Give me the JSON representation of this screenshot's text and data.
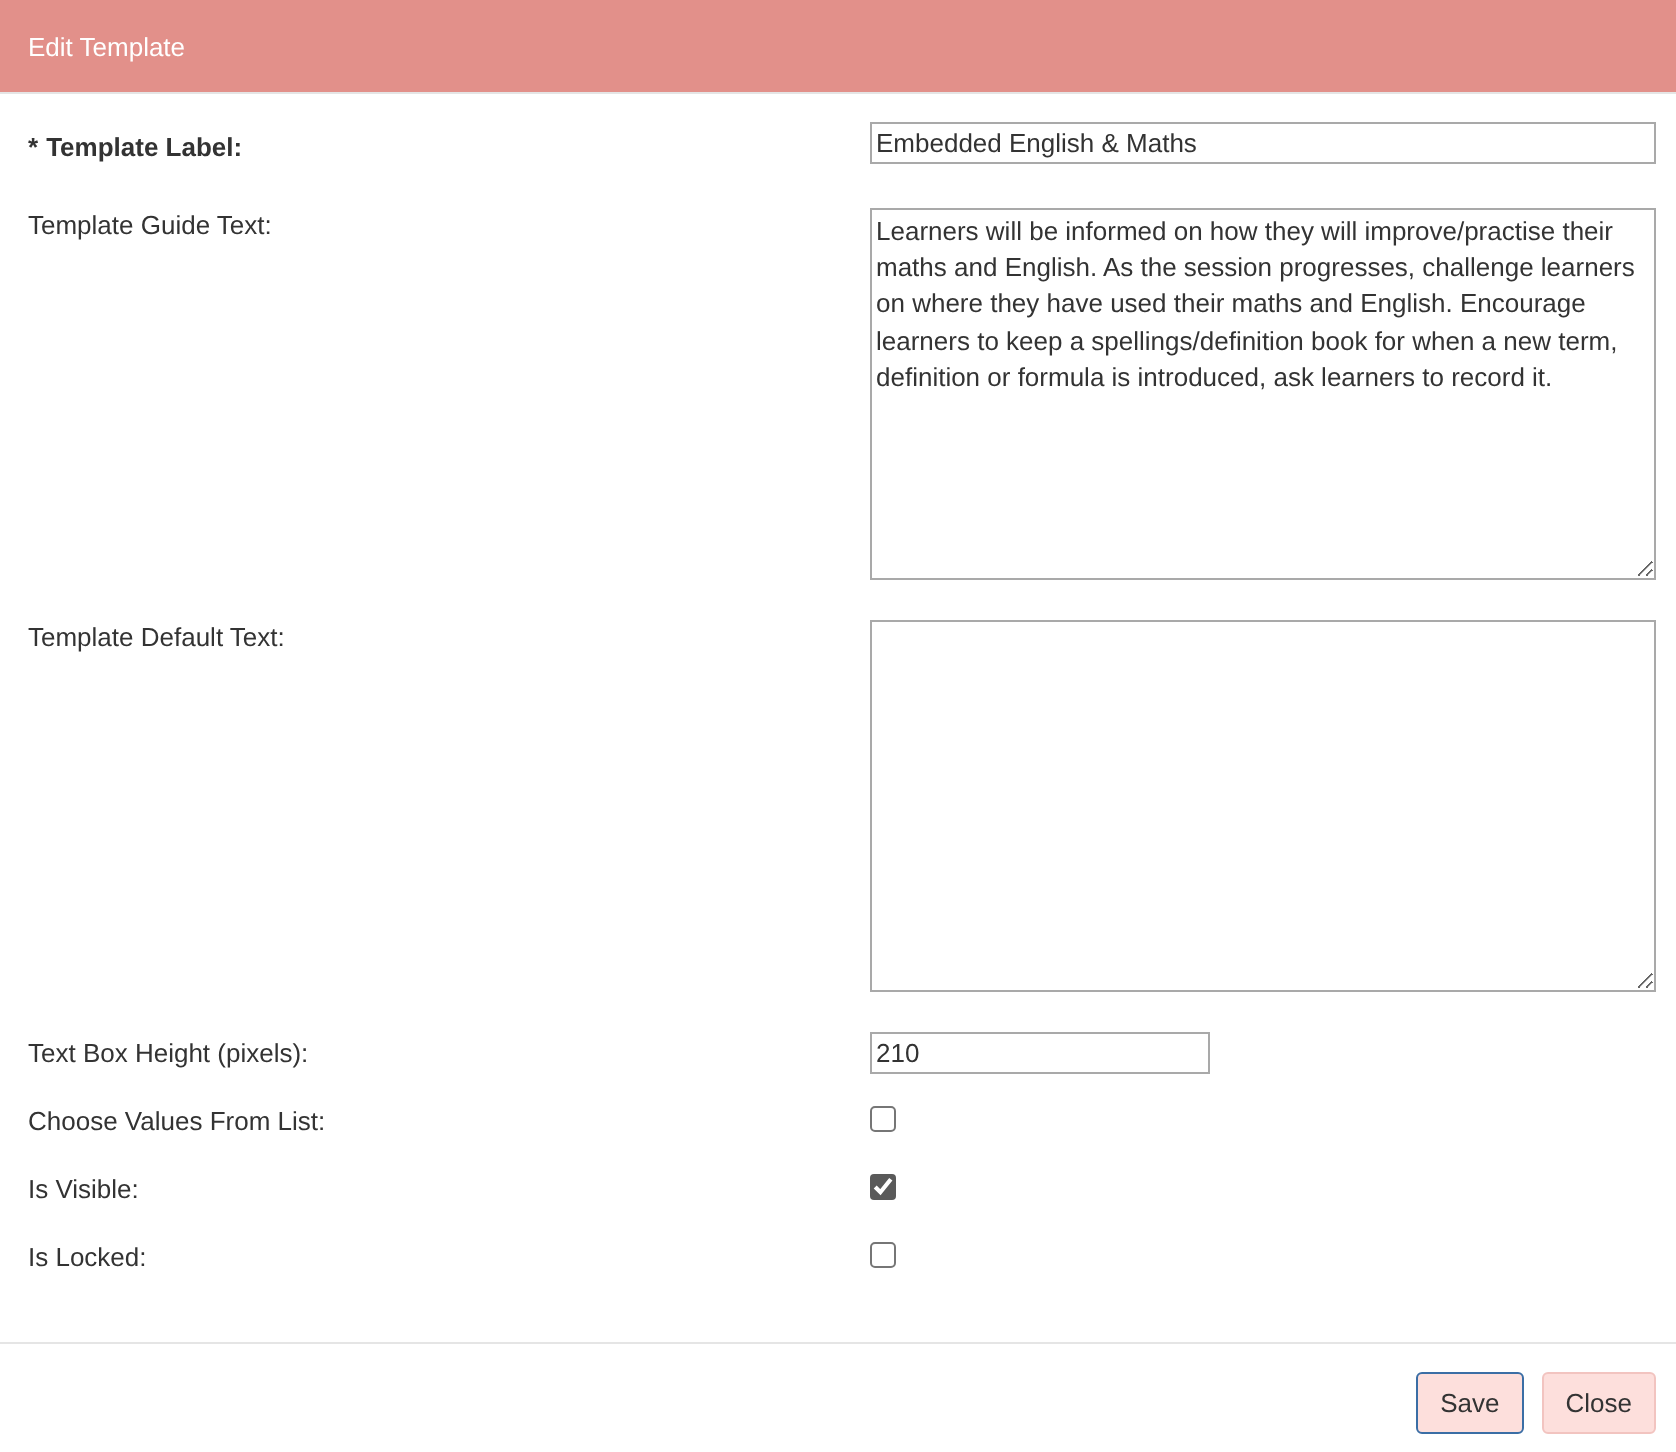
{
  "dialog": {
    "title": "Edit Template"
  },
  "fields": [
    {
      "kind": "text",
      "label": "Template Label:",
      "required": true,
      "marker": "*",
      "value": "Embedded English & Maths"
    },
    {
      "kind": "textarea",
      "label": "Template Guide Text:",
      "required": false,
      "value": "Learners will be informed on how they will improve/practise their maths and English. As the session progresses, challenge learners on where they have used their maths and English. Encourage learners to keep a spellings/definition book for when a new term, definition or formula is introduced, ask learners to record it."
    },
    {
      "kind": "textarea",
      "label": "Template Default Text:",
      "required": false
    },
    {
      "kind": "short",
      "label": "Text Box Height (pixels):",
      "required": false,
      "value": "210"
    },
    {
      "kind": "checkbox",
      "label": "Choose Values From List:",
      "required": false,
      "checked": false
    },
    {
      "kind": "checkbox",
      "label": "Is Visible:",
      "required": false,
      "checked": true
    },
    {
      "kind": "checkbox",
      "label": "Is Locked:",
      "required": false,
      "checked": false
    }
  ],
  "buttons": [
    {
      "label": "Save",
      "focused": true
    },
    {
      "label": "Close",
      "focused": false
    }
  ]
}
